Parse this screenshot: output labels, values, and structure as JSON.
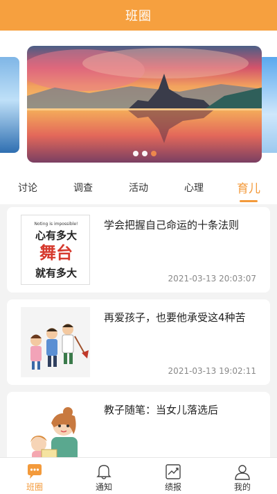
{
  "header": {
    "title": "班圈"
  },
  "banner": {
    "dots": 3,
    "active_dot": 2
  },
  "tabs": [
    {
      "label": "讨论",
      "active": false
    },
    {
      "label": "调查",
      "active": false
    },
    {
      "label": "活动",
      "active": false
    },
    {
      "label": "心理",
      "active": false
    },
    {
      "label": "育儿",
      "active": true
    }
  ],
  "articles": [
    {
      "title": "学会把握自己命运的十条法则",
      "time": "2021-03-13 20:03:07",
      "thumb_text": {
        "top": "Noting is impossible!",
        "line1": "心有多大",
        "line2": "舞台",
        "line3": "就有多大"
      }
    },
    {
      "title": "再爱孩子，也要他承受这4种苦",
      "time": "2021-03-13 19:02:11"
    },
    {
      "title": "教子随笔：当女儿落选后",
      "time": ""
    }
  ],
  "bottom_nav": [
    {
      "label": "班圈",
      "icon": "chat-bubble-icon",
      "active": true
    },
    {
      "label": "通知",
      "icon": "bell-icon",
      "active": false
    },
    {
      "label": "绩报",
      "icon": "report-chart-icon",
      "active": false
    },
    {
      "label": "我的",
      "icon": "user-icon",
      "active": false
    }
  ],
  "colors": {
    "accent": "#f39a3b",
    "header": "#f6a03f"
  }
}
